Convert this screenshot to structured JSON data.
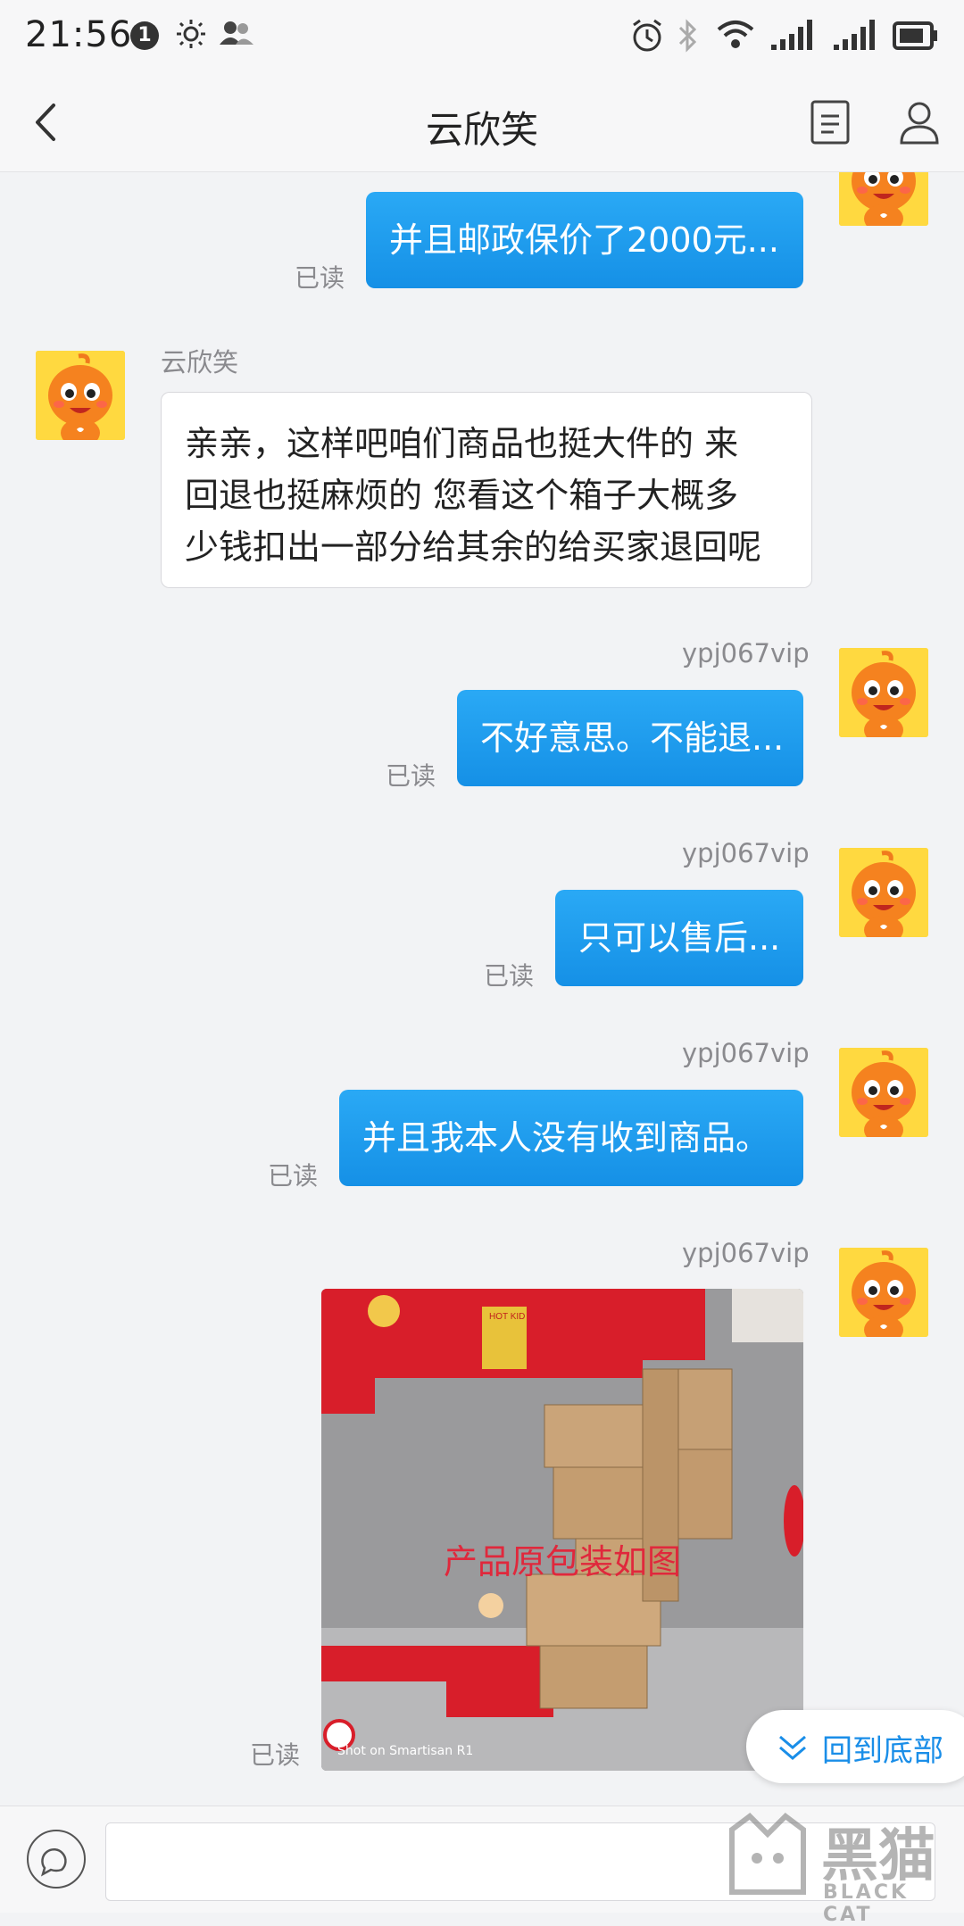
{
  "status_bar": {
    "time": "21:56",
    "notification_count": "1",
    "icons": [
      "brightness-icon",
      "contacts-icon",
      "alarm-icon",
      "bluetooth-icon",
      "wifi-icon",
      "signal-1-icon",
      "signal-2-icon",
      "battery-icon"
    ]
  },
  "header": {
    "title": "云欣笑",
    "back_icon": "back-arrow-icon",
    "menu_icon": "document-icon",
    "profile_icon": "user-icon"
  },
  "messages": [
    {
      "direction": "out",
      "sender": "ypj067vip",
      "text": "并且邮政保价了2000元...",
      "status": "已读"
    },
    {
      "direction": "in",
      "sender": "云欣笑",
      "lines": [
        "亲亲，这样吧咱们商品也挺大件的 来",
        "回退也挺麻烦的 您看这个箱子大概多",
        "少钱扣出一部分给其余的给买家退回呢"
      ]
    },
    {
      "direction": "out",
      "sender": "ypj067vip",
      "text": "不好意思。不能退...",
      "status": "已读"
    },
    {
      "direction": "out",
      "sender": "ypj067vip",
      "text": "只可以售后...",
      "status": "已读"
    },
    {
      "direction": "out",
      "sender": "ypj067vip",
      "text": "并且我本人没有收到商品。",
      "status": "已读"
    },
    {
      "direction": "out",
      "sender": "ypj067vip",
      "type": "image",
      "caption": "产品原包装如图",
      "footer": "Shot on Smartisan R1",
      "sign": "HOT KID",
      "status": "已读"
    }
  ],
  "scroll_to_bottom": {
    "label": "回到底部",
    "icon": "double-chevron-down-icon"
  },
  "input_bar": {
    "icon": "chat-bubble-icon",
    "placeholder": ""
  },
  "watermark": {
    "text": "黑猫",
    "sub": "BLACK CAT"
  },
  "colors": {
    "outgoing_bubble": "#1e9cf0",
    "accent": "#1a8ee8",
    "background": "#f2f3f5"
  }
}
